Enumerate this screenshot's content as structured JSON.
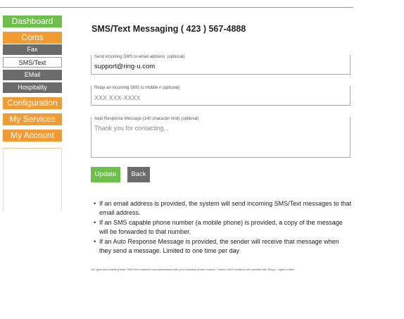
{
  "sidebar": {
    "dashboard": "Dashboard",
    "coms": "Coms",
    "coms_items": [
      "Fax",
      "SMS/Text",
      "EMail",
      "Hospitality"
    ],
    "configuration": "Configuration",
    "my_services": "My Services",
    "my_account": "My Account"
  },
  "page": {
    "title": "SMS/Text Messaging ( 423 ) 567-4888"
  },
  "form": {
    "email": {
      "label": "Send incoming SMS to email address: (optional)",
      "value": "support@ring-u.com"
    },
    "relay": {
      "label": "Relay an incoming SMS to mobile # (optional)",
      "placeholder": "XXX XXX-XXXX"
    },
    "autoresponse": {
      "label": "Auto Response Message (140 character limit) (optional)",
      "placeholder": "Thank you for contacting..."
    }
  },
  "buttons": {
    "update": "Update",
    "back": "Back"
  },
  "notes": [
    "If an email address is provided, the system will send incoming SMS/Text messages to that email address.",
    "If an SMS capable phone number (a mobile phone) is provided, a copy of the message will be forwarded to that number.",
    "If an Auto Response Message is provided, the sender will receive that message when they send a message. Limited to one time per day"
  ],
  "footnote": "Our goal was enabling basic SMS/Text customer communications with your business phone number. Custom SMS solutions are possible with Ring-u. Inquire within.",
  "colors": {
    "green": "#6cbf4a",
    "orange": "#f29b32",
    "gray": "#6b6b6b"
  }
}
